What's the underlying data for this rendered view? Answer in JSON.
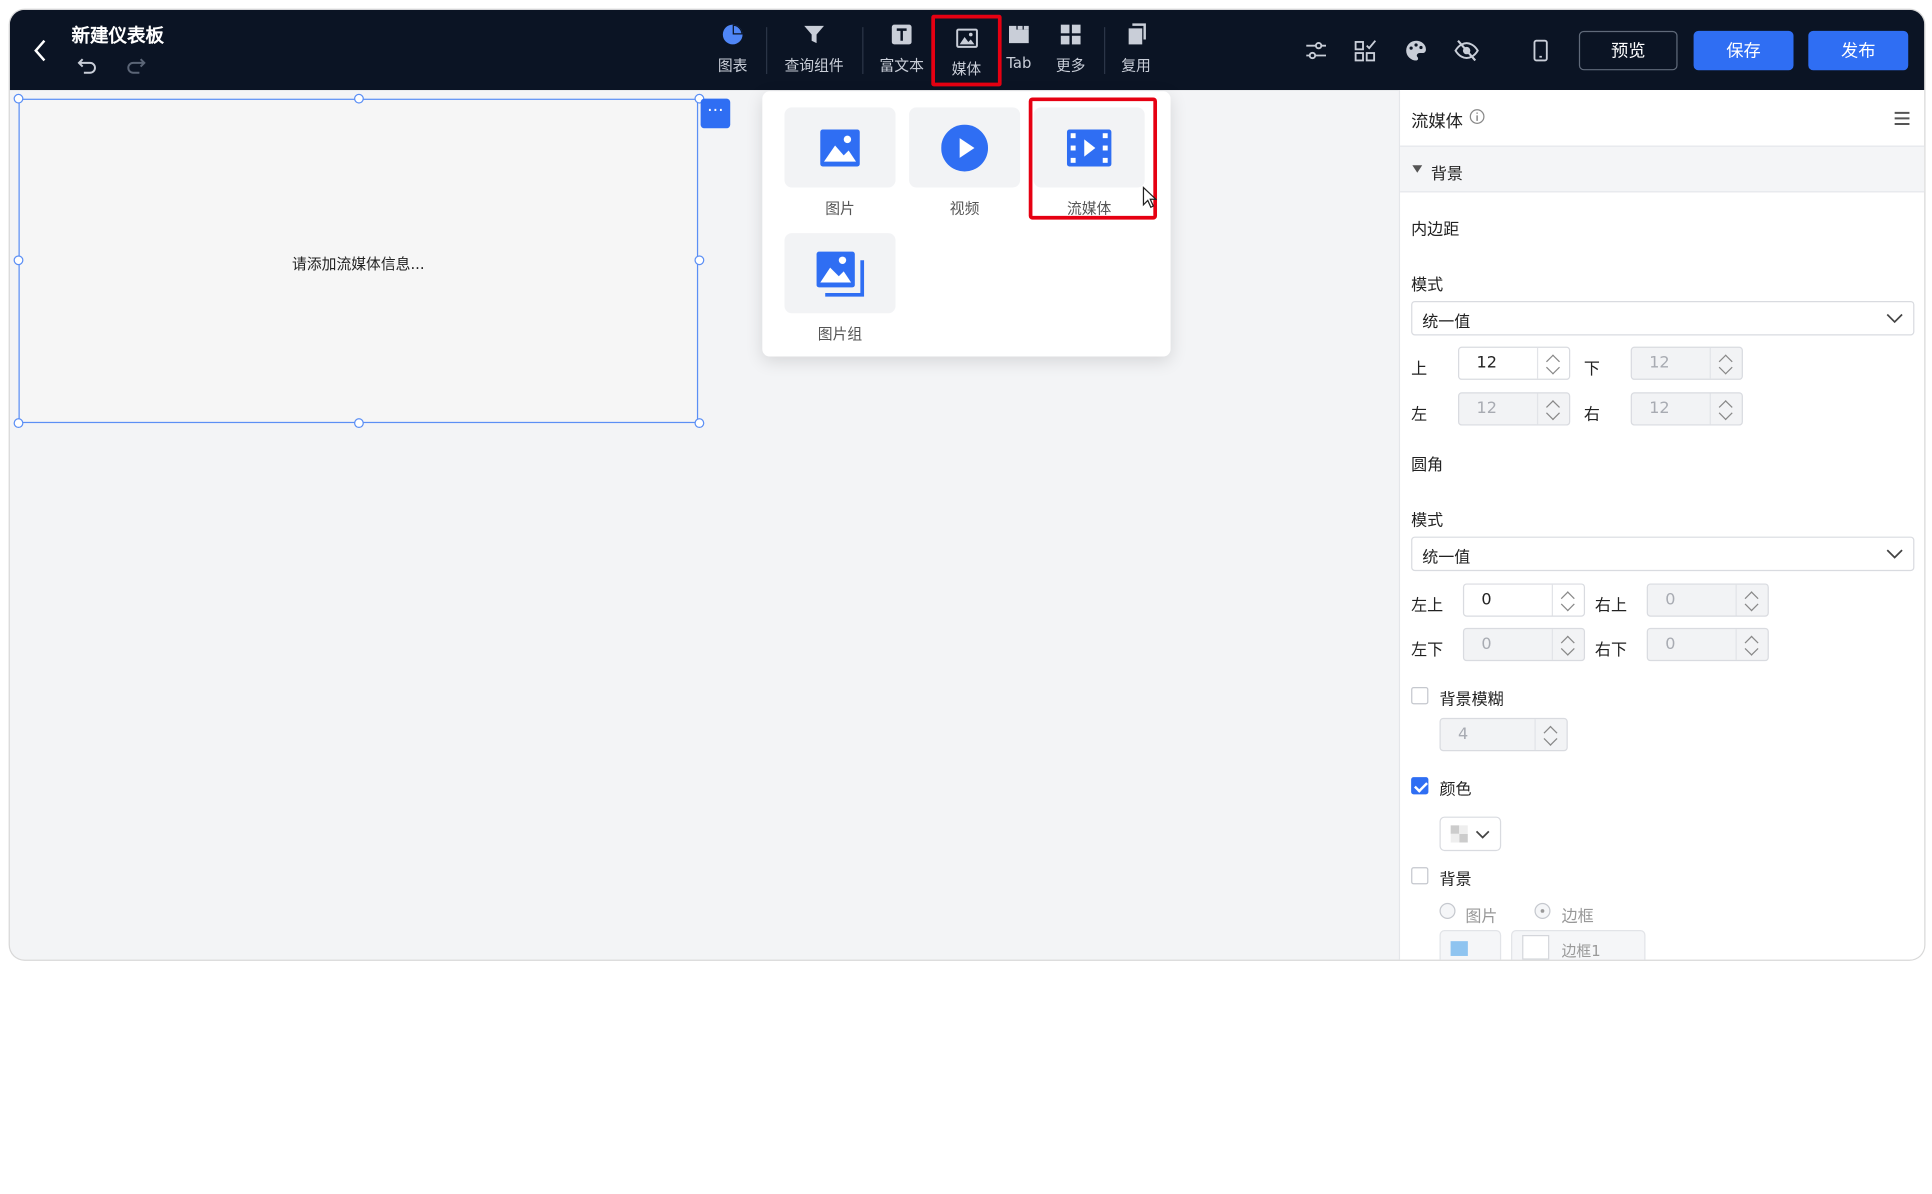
{
  "header": {
    "title": "新建仪表板",
    "tools": [
      {
        "label": "图表",
        "icon": "pie-chart-icon"
      },
      {
        "label": "查询组件",
        "icon": "filter-icon"
      },
      {
        "label": "富文本",
        "icon": "text-icon"
      },
      {
        "label": "媒体",
        "icon": "image-icon"
      },
      {
        "label": "Tab",
        "icon": "tab-icon"
      },
      {
        "label": "更多",
        "icon": "grid-icon"
      },
      {
        "label": "复用",
        "icon": "copy-icon"
      }
    ],
    "buttons": {
      "preview": "预览",
      "save": "保存",
      "publish": "发布"
    }
  },
  "canvas": {
    "placeholder": "请添加流媒体信息...",
    "more_label": "···"
  },
  "media_menu": {
    "items": [
      {
        "label": "图片",
        "icon": "image-icon"
      },
      {
        "label": "视频",
        "icon": "play-icon"
      },
      {
        "label": "流媒体",
        "icon": "film-icon"
      },
      {
        "label": "图片组",
        "icon": "image-group-icon"
      }
    ]
  },
  "panel": {
    "title": "流媒体",
    "section": "背景",
    "padding": {
      "label": "内边距",
      "mode_label": "模式",
      "mode_value": "统一值",
      "top_label": "上",
      "top_value": "12",
      "bottom_label": "下",
      "bottom_value": "12",
      "left_label": "左",
      "left_value": "12",
      "right_label": "右",
      "right_value": "12"
    },
    "radius": {
      "label": "圆角",
      "mode_label": "模式",
      "mode_value": "统一值",
      "tl_label": "左上",
      "tl_value": "0",
      "tr_label": "右上",
      "tr_value": "0",
      "bl_label": "左下",
      "bl_value": "0",
      "br_label": "右下",
      "br_value": "0"
    },
    "blur": {
      "label": "背景模糊",
      "value": "4",
      "checked": false
    },
    "color": {
      "label": "颜色",
      "checked": true
    },
    "background": {
      "label": "背景",
      "checked": false,
      "opt_image": "图片",
      "opt_border": "边框",
      "border_value": "边框1"
    }
  },
  "colors": {
    "accent": "#2f6ef3",
    "topbar": "#0b1424",
    "highlight": "#e60012"
  }
}
